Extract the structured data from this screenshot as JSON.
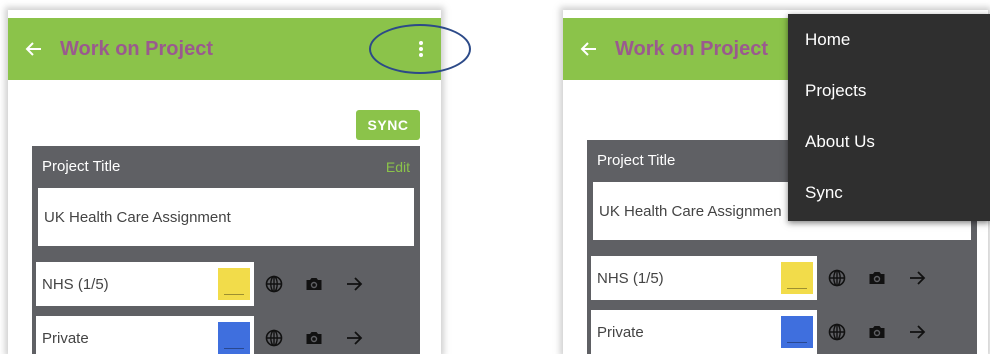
{
  "app_bar": {
    "title": "Work on Project",
    "color": "#8bc34a",
    "title_color": "#9a5a8e",
    "back_icon": "arrow-back-icon",
    "overflow_icon": "more-vertical-icon"
  },
  "sync_label": "SYNC",
  "project": {
    "header": "Project Title",
    "edit_label": "Edit",
    "title_value": "UK Health Care Assignment",
    "right_title_value": "UK Health Care Assignmen"
  },
  "rows": [
    {
      "label": "NHS (1/5)",
      "color": "#f2dc4a"
    },
    {
      "label": "Private",
      "color": "#3f6fde"
    }
  ],
  "menu": {
    "items": [
      "Home",
      "Projects",
      "About Us",
      "Sync"
    ]
  }
}
